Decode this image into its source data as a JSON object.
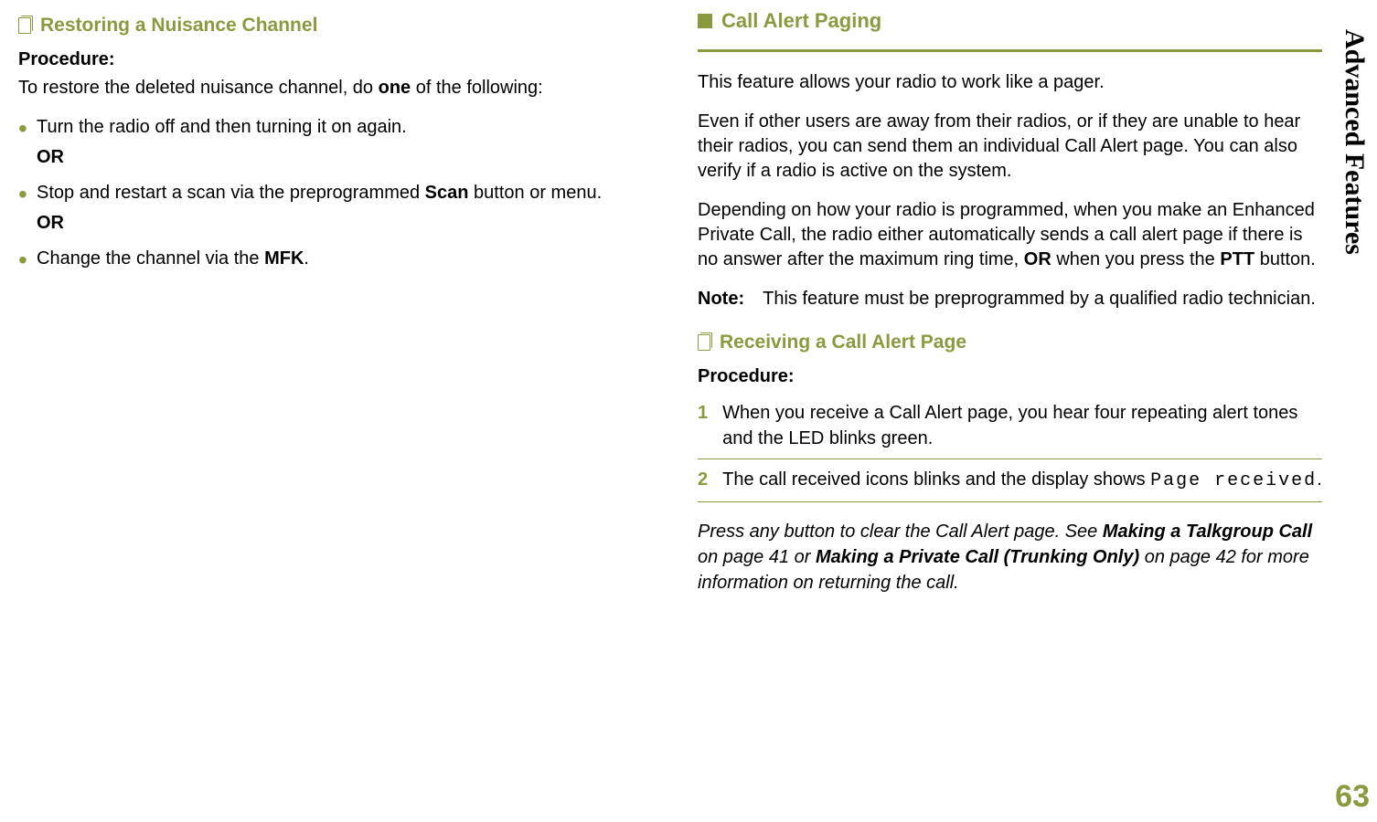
{
  "sideLabel": "Advanced Features",
  "pageNumber": "63",
  "left": {
    "subHeading": "Restoring a Nuisance Channel",
    "procLabel": "Procedure:",
    "intro_pre": "To restore the deleted nuisance channel, do ",
    "intro_bold": "one",
    "intro_post": " of the following:",
    "bullet1": "Turn the radio off and then turning it on again.",
    "or1": "OR",
    "bullet2_pre": "Stop and restart a scan via the preprogrammed ",
    "bullet2_bold": "Scan",
    "bullet2_post": " button or menu.",
    "or2": "OR",
    "bullet3_pre": "Change the channel via the ",
    "bullet3_bold": "MFK",
    "bullet3_post": "."
  },
  "right": {
    "sectionHeading": "Call Alert Paging",
    "p1": "This feature allows your radio to work like a pager.",
    "p2": "Even if other users are away from their radios, or if they are unable to hear their radios, you can send them an individual Call Alert page. You can also verify if a radio is active on the system.",
    "p3_a": "Depending on how your radio is programmed, when you make an Enhanced Private Call, the radio either automatically sends a call alert page if there is no answer after the maximum ring time, ",
    "p3_or": "OR",
    "p3_b": " when you press the ",
    "p3_ptt": "PTT",
    "p3_c": " button.",
    "noteLabel": "Note:",
    "noteText": "This feature must be preprogrammed by a qualified radio technician.",
    "subHeading": "Receiving a Call Alert Page",
    "procLabel": "Procedure:",
    "step1Num": "1",
    "step1": "When you receive a Call Alert page, you hear four repeating alert tones and the LED blinks green.",
    "step2Num": "2",
    "step2_pre": "The call received icons blinks and the display shows ",
    "step2_code": "Page received",
    "step2_post": ".",
    "closing_a": "Press any button to clear the Call Alert page. See ",
    "closing_b1": "Making a Talkgroup Call",
    "closing_c": " on page 41 or ",
    "closing_b2": "Making a Private Call (Trunking Only)",
    "closing_d": " on page 42 for more information on returning the call."
  }
}
